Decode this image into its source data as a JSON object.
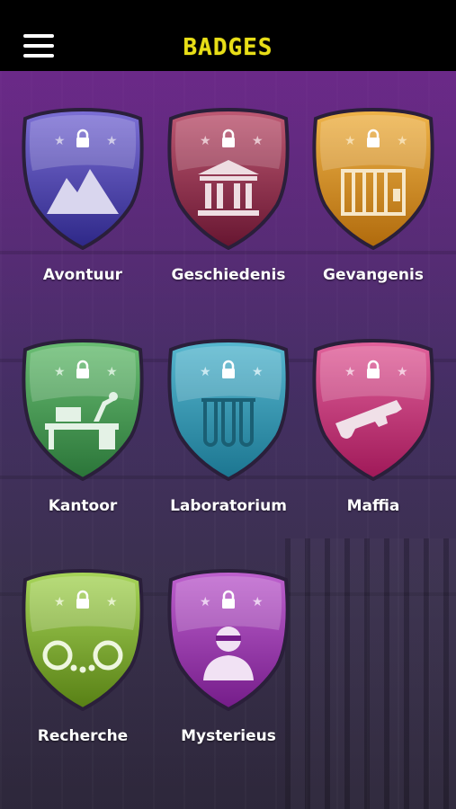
{
  "header": {
    "title": "BADGES"
  },
  "badges": [
    {
      "label": "Avontuur",
      "icon": "mountain-icon",
      "color_top": "#6a5cc2",
      "color_bottom": "#2f2a86"
    },
    {
      "label": "Geschiedenis",
      "icon": "temple-icon",
      "color_top": "#b3506a",
      "color_bottom": "#6a1830"
    },
    {
      "label": "Gevangenis",
      "icon": "prison-bars-icon",
      "color_top": "#e2a63a",
      "color_bottom": "#b46d0e"
    },
    {
      "label": "Kantoor",
      "icon": "desk-icon",
      "color_top": "#5fb06a",
      "color_bottom": "#2d7a3b"
    },
    {
      "label": "Laboratorium",
      "icon": "test-tubes-icon",
      "color_top": "#4aaec7",
      "color_bottom": "#1f7c98"
    },
    {
      "label": "Maffia",
      "icon": "pistol-icon",
      "color_top": "#d9508f",
      "color_bottom": "#a31c5c"
    },
    {
      "label": "Recherche",
      "icon": "handcuffs-icon",
      "color_top": "#9ccd4a",
      "color_bottom": "#5c8a18"
    },
    {
      "label": "Mysterieus",
      "icon": "masked-person-icon",
      "color_top": "#b252c2",
      "color_bottom": "#7a1f8d"
    }
  ],
  "colors": {
    "title": "#e8de18",
    "header_bg": "#000000"
  }
}
